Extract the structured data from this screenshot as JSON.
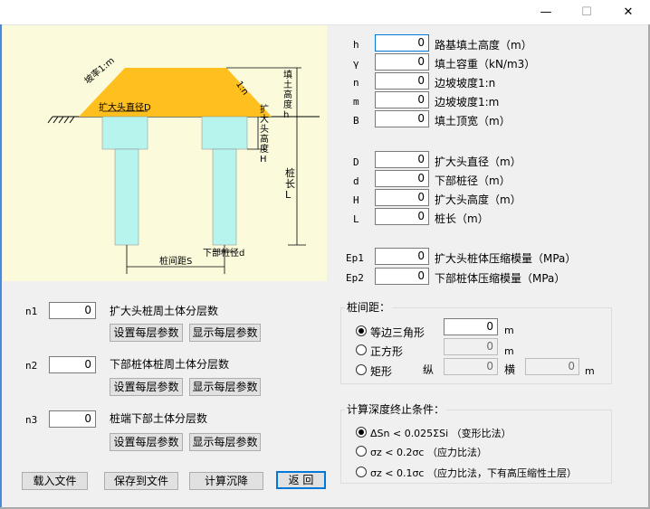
{
  "window": {
    "minimize": "—",
    "maximize": "☐",
    "close": "✕"
  },
  "diagram": {
    "slope_left": "坡率1:m",
    "slope_right": "1:n",
    "fill_height": "填土高度h",
    "cap_diameter": "扩大头直径D",
    "cap_height": "扩大头高度H",
    "pile_length": "桩长L",
    "pile_spacing": "桩间距S",
    "pile_diameter": "下部桩径d"
  },
  "params": [
    {
      "sym": "h",
      "value": "0",
      "label": "路基填土高度（m）"
    },
    {
      "sym": "γ",
      "value": "0",
      "label": "填土容重（kN/m3）"
    },
    {
      "sym": "n",
      "value": "0",
      "label": "边坡坡度1:n"
    },
    {
      "sym": "m",
      "value": "0",
      "label": "边坡坡度1:m"
    },
    {
      "sym": "B",
      "value": "0",
      "label": "填土顶宽（m）"
    },
    {
      "sym": "D",
      "value": "0",
      "label": "扩大头直径（m）"
    },
    {
      "sym": "d",
      "value": "0",
      "label": "下部桩径（m）"
    },
    {
      "sym": "H",
      "value": "0",
      "label": "扩大头高度（m）"
    },
    {
      "sym": "L",
      "value": "0",
      "label": "桩长（m）"
    },
    {
      "sym": "Ep1",
      "value": "0",
      "label": "扩大头桩体压缩模量（MPa）"
    },
    {
      "sym": "Ep2",
      "value": "0",
      "label": "下部桩体压缩模量（MPa）"
    }
  ],
  "layers": [
    {
      "sym": "n1",
      "value": "0",
      "label": "扩大头桩周土体分层数"
    },
    {
      "sym": "n2",
      "value": "0",
      "label": "下部桩体桩周土体分层数"
    },
    {
      "sym": "n3",
      "value": "0",
      "label": "桩端下部土体分层数"
    }
  ],
  "layer_buttons": {
    "set": "设置每层参数",
    "show": "显示每层参数"
  },
  "spacing": {
    "title": "桩间距：",
    "options": [
      "等边三角形",
      "正方形",
      "矩形"
    ],
    "selected": 0,
    "tri_value": "0",
    "square_value": "0",
    "rect_long": "0",
    "rect_trans": "0",
    "unit": "m",
    "long_label": "纵",
    "trans_label": "横"
  },
  "criteria": {
    "title": "计算深度终止条件：",
    "options": [
      "ΔSn < 0.025ΣSi （变形比法）",
      "σz < 0.2σc （应力比法）",
      "σz < 0.1σc （应力比法，下有高压缩性土层）"
    ],
    "selected": 0
  },
  "bottom_buttons": {
    "load": "载入文件",
    "save": "保存到文件",
    "calc": "计算沉降",
    "back": "返 回"
  }
}
